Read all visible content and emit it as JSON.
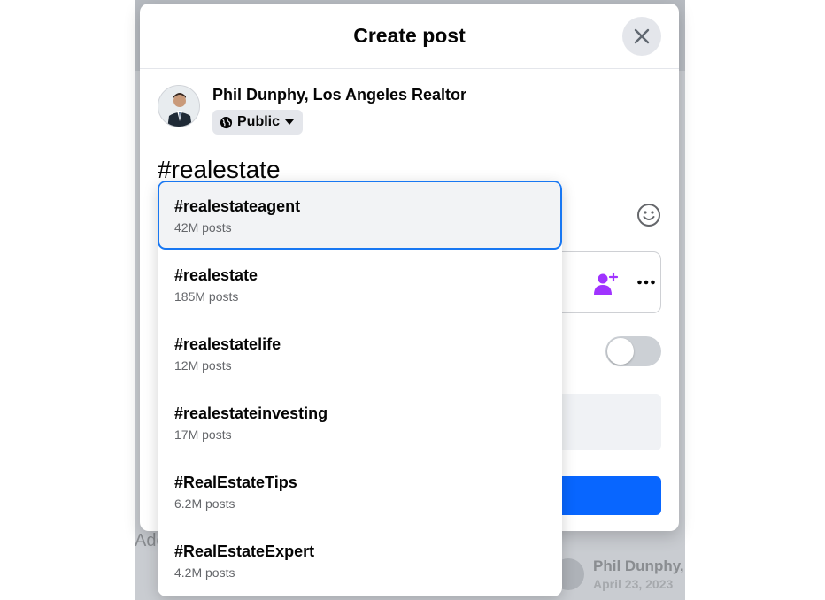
{
  "background": {
    "left_text": "Add",
    "footer_name": "Phil Dunphy,",
    "footer_date": "April 23, 2023"
  },
  "modal": {
    "title": "Create post",
    "author_name": "Phil Dunphy, Los Angeles Realtor",
    "privacy": "Public",
    "post_text": "#realestate"
  },
  "suggestions": [
    {
      "tag": "#realestateagent",
      "count": "42M posts"
    },
    {
      "tag": "#realestate",
      "count": "185M posts"
    },
    {
      "tag": "#realestatelife",
      "count": "12M posts"
    },
    {
      "tag": "#realestateinvesting",
      "count": "17M posts"
    },
    {
      "tag": "#RealEstateTips",
      "count": "6.2M posts"
    },
    {
      "tag": "#RealEstateExpert",
      "count": "4.2M posts"
    }
  ],
  "colors": {
    "accent": "#1877f2",
    "post_button": "#0866ff",
    "tag_icon": "#a033ff"
  },
  "icons": {
    "close": "close-icon",
    "globe": "globe-icon",
    "caret": "caret-down-icon",
    "emoji": "smiley-icon",
    "tag": "tag-people-icon",
    "more": "more-icon"
  }
}
